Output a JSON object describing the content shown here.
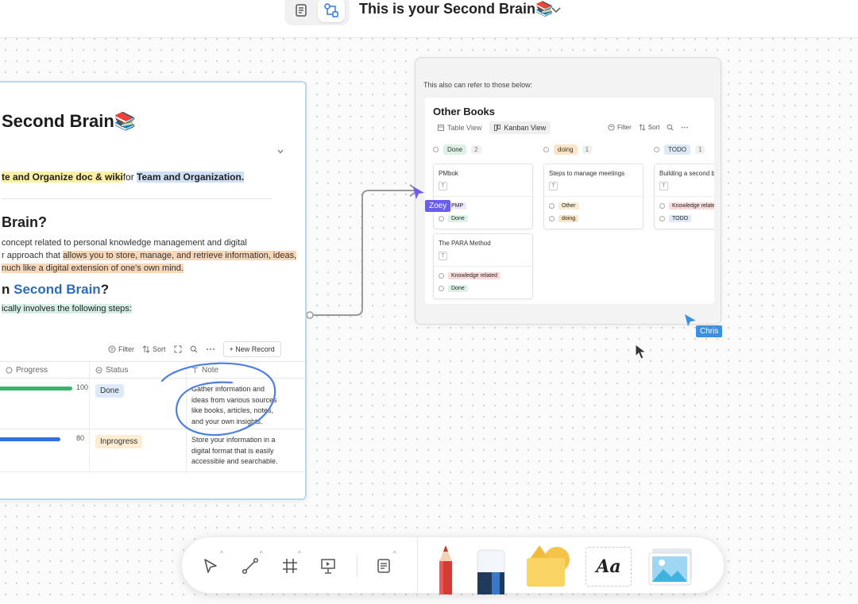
{
  "header": {
    "title": "This is your Second Brain📚",
    "mode_doc_icon": "doc-icon",
    "mode_edgeless_icon": "edgeless-icon"
  },
  "doc": {
    "heading": "Second Brain📚",
    "line1_a": "te and Organize doc & wiki",
    "line1_b": "for ",
    "line1_c": "Team and Organization.",
    "h2": "Brain?",
    "para_1": "concept related to personal knowledge management and digital",
    "para_2a": "r approach that ",
    "para_2b": "allows you to store, manage, and retrieve information, ideas,",
    "para_3": "nuch like a digital extension of one's own mind.",
    "h3_a": "n ",
    "h3_b": "Second Brain",
    "h3_c": "?",
    "steps": "ically involves the following steps:",
    "toolbar": {
      "filter": "Filter",
      "sort": "Sort",
      "new_record": "+ New Record"
    },
    "columns": {
      "progress": "Progress",
      "status": "Status",
      "note": "Note"
    },
    "rows": [
      {
        "progress": 100,
        "progress_label": "100",
        "status": "Done",
        "note_lines": [
          "Gather information and",
          "ideas from various sources",
          "like books, articles, notes,",
          "and your own insights."
        ]
      },
      {
        "progress": 80,
        "progress_label": "80",
        "status": "Inprogress",
        "note_lines": [
          "Store your information in a",
          "digital format that is easily",
          "accessible and searchable."
        ]
      }
    ]
  },
  "kanban": {
    "refer": "This also can refer to those below:",
    "title": "Other Books",
    "tabs": [
      "Table View",
      "Kanban View"
    ],
    "filter": "Filter",
    "sort": "Sort",
    "groups": [
      {
        "label": "Done",
        "count": "2"
      },
      {
        "label": "doing",
        "count": "1"
      },
      {
        "label": "TODO",
        "count": "1"
      }
    ],
    "cards": [
      {
        "title": "PMbok",
        "tag": "PMP",
        "status": "Done"
      },
      {
        "title": "The PARA Method",
        "tag": "Knowledge related",
        "status": "Done"
      },
      {
        "title": "Steps to manage meetings",
        "tag": "Other",
        "status": "doing"
      },
      {
        "title": "Building a second bra",
        "tag": "Knowledge related",
        "status": "TODO"
      }
    ]
  },
  "cursors": [
    {
      "name": "Zoey",
      "color": "#6a5cf0"
    },
    {
      "name": "Chris",
      "color": "#3d8fe0"
    }
  ],
  "toolbar_bottom": {
    "tools": [
      "select-icon",
      "connector-icon",
      "frame-icon",
      "presentation-icon",
      "note-icon"
    ],
    "text_tool_label": "Aa"
  },
  "colors": {
    "progress_done": "#3bb56b",
    "progress_inprogress": "#3471e0",
    "accent_blue": "#2f6cb8"
  }
}
